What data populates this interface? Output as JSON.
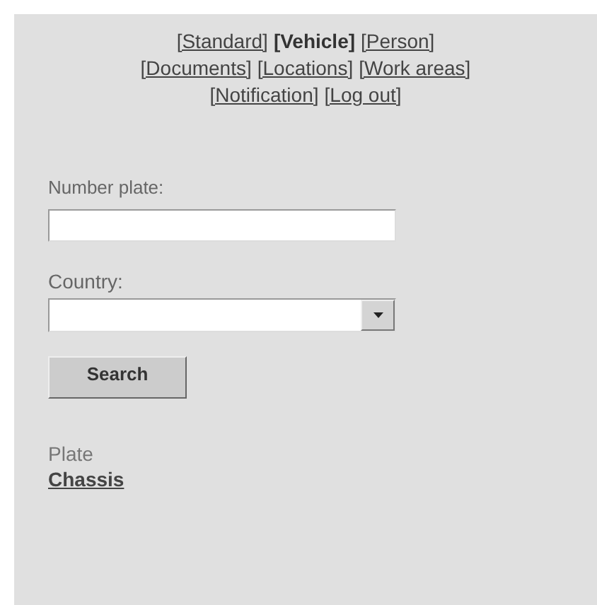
{
  "nav_rows": [
    {
      "links": [
        {
          "label": "[Standard]",
          "selected": false
        },
        {
          "label": "[Vehicle]",
          "selected": true
        },
        {
          "label": "[Person]",
          "selected": false
        }
      ]
    },
    {
      "links": [
        {
          "label": "[Documents]",
          "selected": false
        },
        {
          "label": "[Locations]",
          "selected": false
        },
        {
          "label": "[Work areas]",
          "selected": false
        }
      ]
    },
    {
      "links": [
        {
          "label": "[Notification]",
          "selected": false
        },
        {
          "label": "[Log out]",
          "selected": false
        }
      ]
    }
  ],
  "number_plate": {
    "label": "Number plate:"
  },
  "country": {
    "label": "Country:"
  },
  "search_button": "Search",
  "search_modes": [
    {
      "label": "Plate",
      "selected": true
    },
    {
      "label": "Chassis",
      "selected": false
    }
  ]
}
